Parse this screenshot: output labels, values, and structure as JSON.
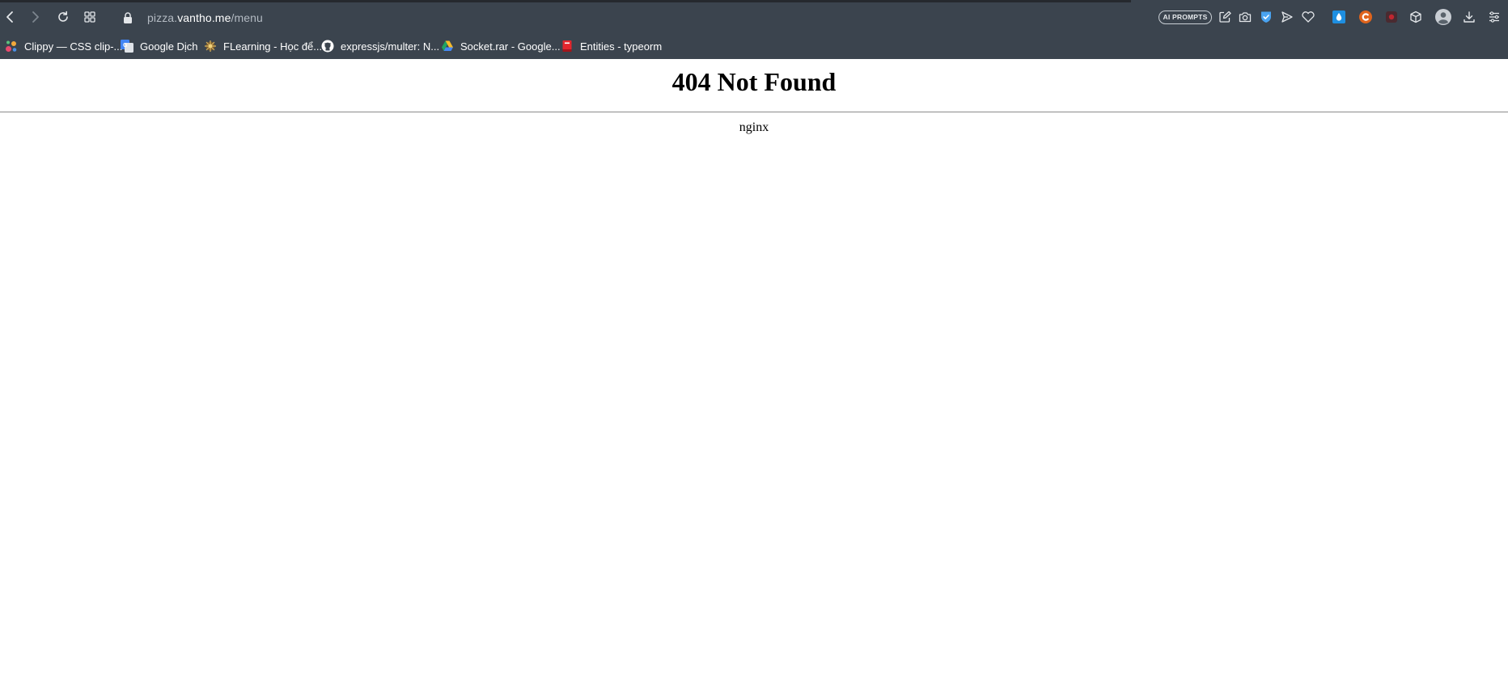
{
  "browser": {
    "address_bar": {
      "scheme_prefix": "pizza.",
      "host": "vantho.me",
      "path": "/menu"
    },
    "toolbar": {
      "ai_prompts_label": "AI PROMPTS"
    },
    "bookmarks": [
      {
        "label": "Clippy — CSS clip-...",
        "icon": "clippy-favicon"
      },
      {
        "label": "Google Dịch",
        "icon": "google-translate-favicon"
      },
      {
        "label": "FLearning - Học để...",
        "icon": "flearning-favicon"
      },
      {
        "label": "expressjs/multer: N...",
        "icon": "github-favicon"
      },
      {
        "label": "Socket.rar - Google...",
        "icon": "google-drive-favicon"
      },
      {
        "label": "Entities - typeorm",
        "icon": "typeorm-favicon"
      }
    ],
    "colors": {
      "chrome": "#3b444e",
      "url_muted": "#b3bac2",
      "shield": "#4aa3f0"
    }
  },
  "page": {
    "title": "404 Not Found",
    "server": "nginx"
  }
}
